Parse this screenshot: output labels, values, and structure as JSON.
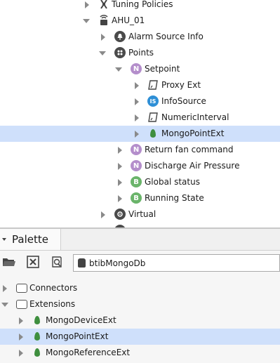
{
  "nav_tree": {
    "items": [
      {
        "label": "Tuning Policies",
        "icon": "tuning-policies-icon"
      },
      {
        "label": "AHU_01",
        "icon": "device-icon"
      },
      {
        "label": "Alarm Source Info",
        "icon": "alarm-source-icon"
      },
      {
        "label": "Points",
        "icon": "points-folder-icon"
      },
      {
        "label": "Setpoint",
        "icon": "numeric-point-icon",
        "badge": "N"
      },
      {
        "label": "Proxy Ext",
        "icon": "proxy-ext-icon"
      },
      {
        "label": "InfoSource",
        "icon": "info-source-icon",
        "badge": "IS"
      },
      {
        "label": "NumericInterval",
        "icon": "numeric-interval-icon"
      },
      {
        "label": "MongoPointExt",
        "icon": "mongo-leaf-icon"
      },
      {
        "label": "Return fan command",
        "icon": "numeric-point-icon",
        "badge": "N"
      },
      {
        "label": "Discharge Air Pressure",
        "icon": "numeric-point-icon",
        "badge": "N"
      },
      {
        "label": "Global status",
        "icon": "boolean-point-icon",
        "badge": "B"
      },
      {
        "label": "Running State",
        "icon": "boolean-point-icon",
        "badge": "B"
      },
      {
        "label": "Virtual",
        "icon": "virtual-icon"
      }
    ]
  },
  "palette": {
    "title": "Palette",
    "module": "btibMongoDb",
    "items": [
      {
        "label": "Connectors",
        "icon": "folder-icon"
      },
      {
        "label": "Extensions",
        "icon": "folder-icon"
      },
      {
        "label": "MongoDeviceExt",
        "icon": "mongo-leaf-icon"
      },
      {
        "label": "MongoPointExt",
        "icon": "mongo-leaf-icon"
      },
      {
        "label": "MongoReferenceExt",
        "icon": "mongo-leaf-icon"
      }
    ]
  },
  "colors": {
    "selection": "#cfe0fb",
    "numeric_badge": "#b48ecb",
    "boolean_badge": "#6ab46a",
    "info_badge": "#2e8fd6",
    "mongo_leaf": "#3f8f3f"
  }
}
